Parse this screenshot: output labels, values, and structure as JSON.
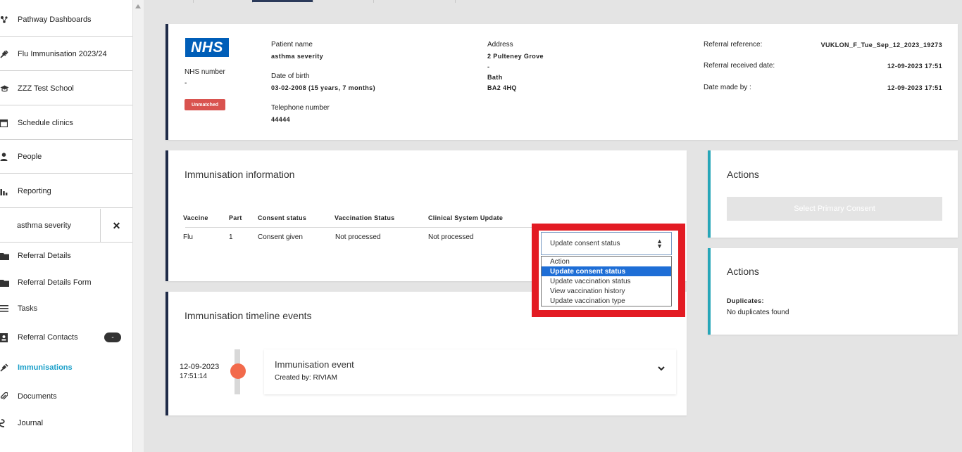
{
  "sidebar": {
    "items": [
      {
        "label": "Pathway Dashboards",
        "icon": "network-icon"
      },
      {
        "label": "Flu Immunisation 2023/24",
        "icon": "syringe-icon"
      },
      {
        "label": "ZZZ Test School",
        "icon": "graduation-cap-icon"
      },
      {
        "label": "Schedule clinics",
        "icon": "calendar-icon"
      },
      {
        "label": "People",
        "icon": "person-icon"
      },
      {
        "label": "Reporting",
        "icon": "bar-chart-icon"
      }
    ],
    "patient_tab": {
      "label": "asthma severity",
      "close": "✕"
    },
    "sub_items": [
      {
        "label": "Referral Details",
        "icon": "folder-icon"
      },
      {
        "label": "Referral Details Form",
        "icon": "folder-icon"
      },
      {
        "label": "Tasks",
        "icon": "list-icon"
      },
      {
        "label": "Referral Contacts",
        "icon": "contact-card-icon",
        "badge": "-"
      },
      {
        "label": "Immunisations",
        "icon": "syringe-icon"
      },
      {
        "label": "Documents",
        "icon": "paperclip-icon"
      },
      {
        "label": "Journal",
        "icon": "journal-icon"
      }
    ]
  },
  "patient": {
    "logo": "NHS",
    "nhs_number_label": "NHS number",
    "nhs_number_value": "-",
    "status_badge": "Unmatched",
    "name_label": "Patient name",
    "name_value": "asthma severity",
    "dob_label": "Date of birth",
    "dob_value": "03-02-2008 (15 years, 7 months)",
    "phone_label": "Telephone number",
    "phone_value": "44444",
    "address_label": "Address",
    "address_lines": [
      "2 Pulteney Grove",
      "-",
      "Bath",
      "BA2 4HQ"
    ],
    "ref_label": "Referral reference:",
    "ref_value": "VUKLON_F_Tue_Sep_12_2023_19273",
    "received_label": "Referral received date:",
    "received_value": "12-09-2023 17:51",
    "made_label": "Date made by :",
    "made_value": "12-09-2023 17:51"
  },
  "immunisation_info": {
    "title": "Immunisation information",
    "headers": [
      "Vaccine",
      "Part",
      "Consent status",
      "Vaccination Status",
      "Clinical System Update"
    ],
    "row": [
      "Flu",
      "1",
      "Consent given",
      "Not processed",
      "Not processed"
    ]
  },
  "action_select": {
    "selected": "Update consent status",
    "options": [
      "Action",
      "Update consent status",
      "Update vaccination status",
      "View vaccination history",
      "Update vaccination type"
    ],
    "highlight_color": "#e31b23"
  },
  "timeline": {
    "title": "Immunisation timeline events",
    "date": "12-09-2023",
    "time": "17:51:14",
    "event_title": "Immunisation event",
    "event_sub": "Created by: RIVIAM"
  },
  "actions1": {
    "title": "Actions",
    "button": "Select Primary Consent"
  },
  "actions2": {
    "title": "Actions",
    "dup_label": "Duplicates:",
    "dup_value": "No duplicates found"
  },
  "colors": {
    "nav_dark": "#1f2b48",
    "teal": "#27a6b8",
    "active_link": "#1a9fc9",
    "nhs_blue": "#005eb8",
    "timeline_dot": "#f26a4b"
  }
}
